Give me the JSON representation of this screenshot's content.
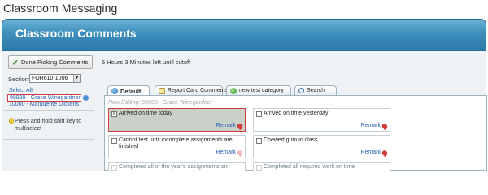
{
  "app": {
    "title": "Classroom Messaging"
  },
  "panel": {
    "title": "Classroom Comments"
  },
  "toolbar": {
    "done_label": "Done Picking Comments",
    "cutoff": "5 Hours 3 Minutes left until cutoff"
  },
  "section": {
    "label": "Section:",
    "value": "FOR610-1006"
  },
  "students": {
    "select_all": "Select All",
    "items": [
      {
        "label": "99999 - Grace Winegardner",
        "selected": true
      },
      {
        "label": "10000 - Marguerite Dickens",
        "selected": false
      }
    ],
    "hint": "Press and hold shift key to multiselect"
  },
  "tabs": [
    {
      "label": "Default",
      "icon": "globe-icon",
      "active": true
    },
    {
      "label": "Report Card Comments",
      "icon": "document-icon",
      "active": false
    },
    {
      "label": "new test category",
      "icon": "green-dot-icon",
      "active": false
    },
    {
      "label": "Search",
      "icon": "magnifier-icon",
      "active": false
    }
  ],
  "editing": "Now Editing: 99999 - Grace Winegardner",
  "comments": [
    {
      "text": "Arrived on time today",
      "checked": true,
      "remark": "Remark"
    },
    {
      "text": "Arrived on time yesterday",
      "checked": false,
      "remark": "Remark"
    },
    {
      "text": "Cannot test until incomplete assignments are finished",
      "checked": false,
      "remark": "Remark"
    },
    {
      "text": "Chewed gum in class",
      "checked": false,
      "remark": "Remark"
    },
    {
      "text": "Completed all of the year's assignments on",
      "checked": false
    },
    {
      "text": "Completed all required work on time",
      "checked": false
    }
  ],
  "colors": {
    "header_top": "#6ab2d4",
    "header_bottom": "#2b7aa9",
    "link": "#2e63b3",
    "selected_border": "#cf3d3d",
    "selected_fill": "#c9d1c9"
  }
}
